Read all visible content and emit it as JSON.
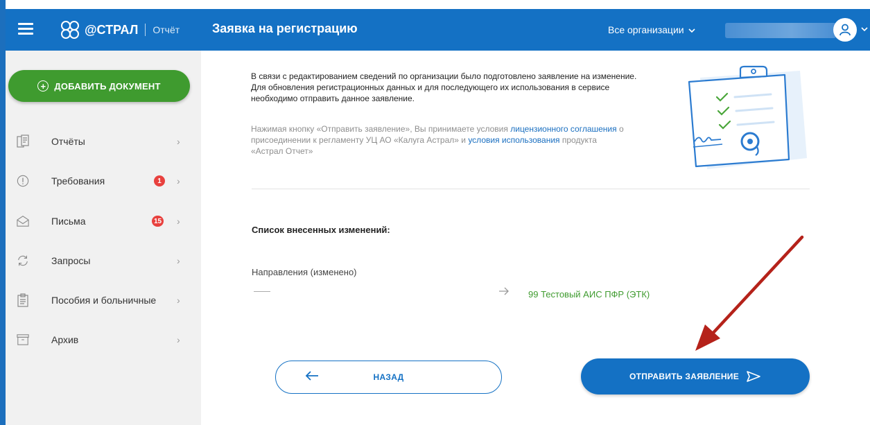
{
  "header": {
    "brand": "@СТРАЛ",
    "product": "Отчёт",
    "page_title": "Заявка на регистрацию",
    "org_selector": "Все организации",
    "org_selector_icon": "chevron-down-icon",
    "avatar_icon": "user-icon"
  },
  "sidebar": {
    "add_button": "ДОБАВИТЬ ДОКУМЕНТ",
    "items": [
      {
        "label": "Отчёты",
        "icon": "reports-icon",
        "badge": ""
      },
      {
        "label": "Требования",
        "icon": "alert-circle-icon",
        "badge": "1"
      },
      {
        "label": "Письма",
        "icon": "envelope-icon",
        "badge": "15"
      },
      {
        "label": "Запросы",
        "icon": "refresh-icon",
        "badge": ""
      },
      {
        "label": "Пособия и больничные",
        "icon": "clipboard-icon",
        "badge": ""
      },
      {
        "label": "Архив",
        "icon": "archive-icon",
        "badge": ""
      }
    ]
  },
  "main": {
    "intro": "В связи с редактированием сведений по организации было подготовлено заявление на изменение. Для обновления регистрационных данных и для последующего их использования в сервисе необходимо отправить данное заявление.",
    "terms": {
      "part1": "Нажимая кнопку «Отправить заявление», Вы принимаете условия ",
      "link1": "лицензионного соглашения",
      "part2": " о присоединении к регламенту УЦ АО «Калуга Астрал» и ",
      "link2": "условия использования",
      "part3": " продукта «Астрал Отчет»"
    },
    "changes_title": "Список внесенных изменений:",
    "field_label": "Направления (изменено)",
    "new_value": "99 Тестовый АИС ПФР (ЭТК)",
    "back_button": "НАЗАД",
    "send_button": "ОТПРАВИТЬ ЗАЯВЛЕНИЕ"
  },
  "colors": {
    "primary": "#1471c4",
    "green": "#3f9b2f",
    "badge_red": "#e8413e",
    "annotation_arrow": "#b5221a"
  }
}
